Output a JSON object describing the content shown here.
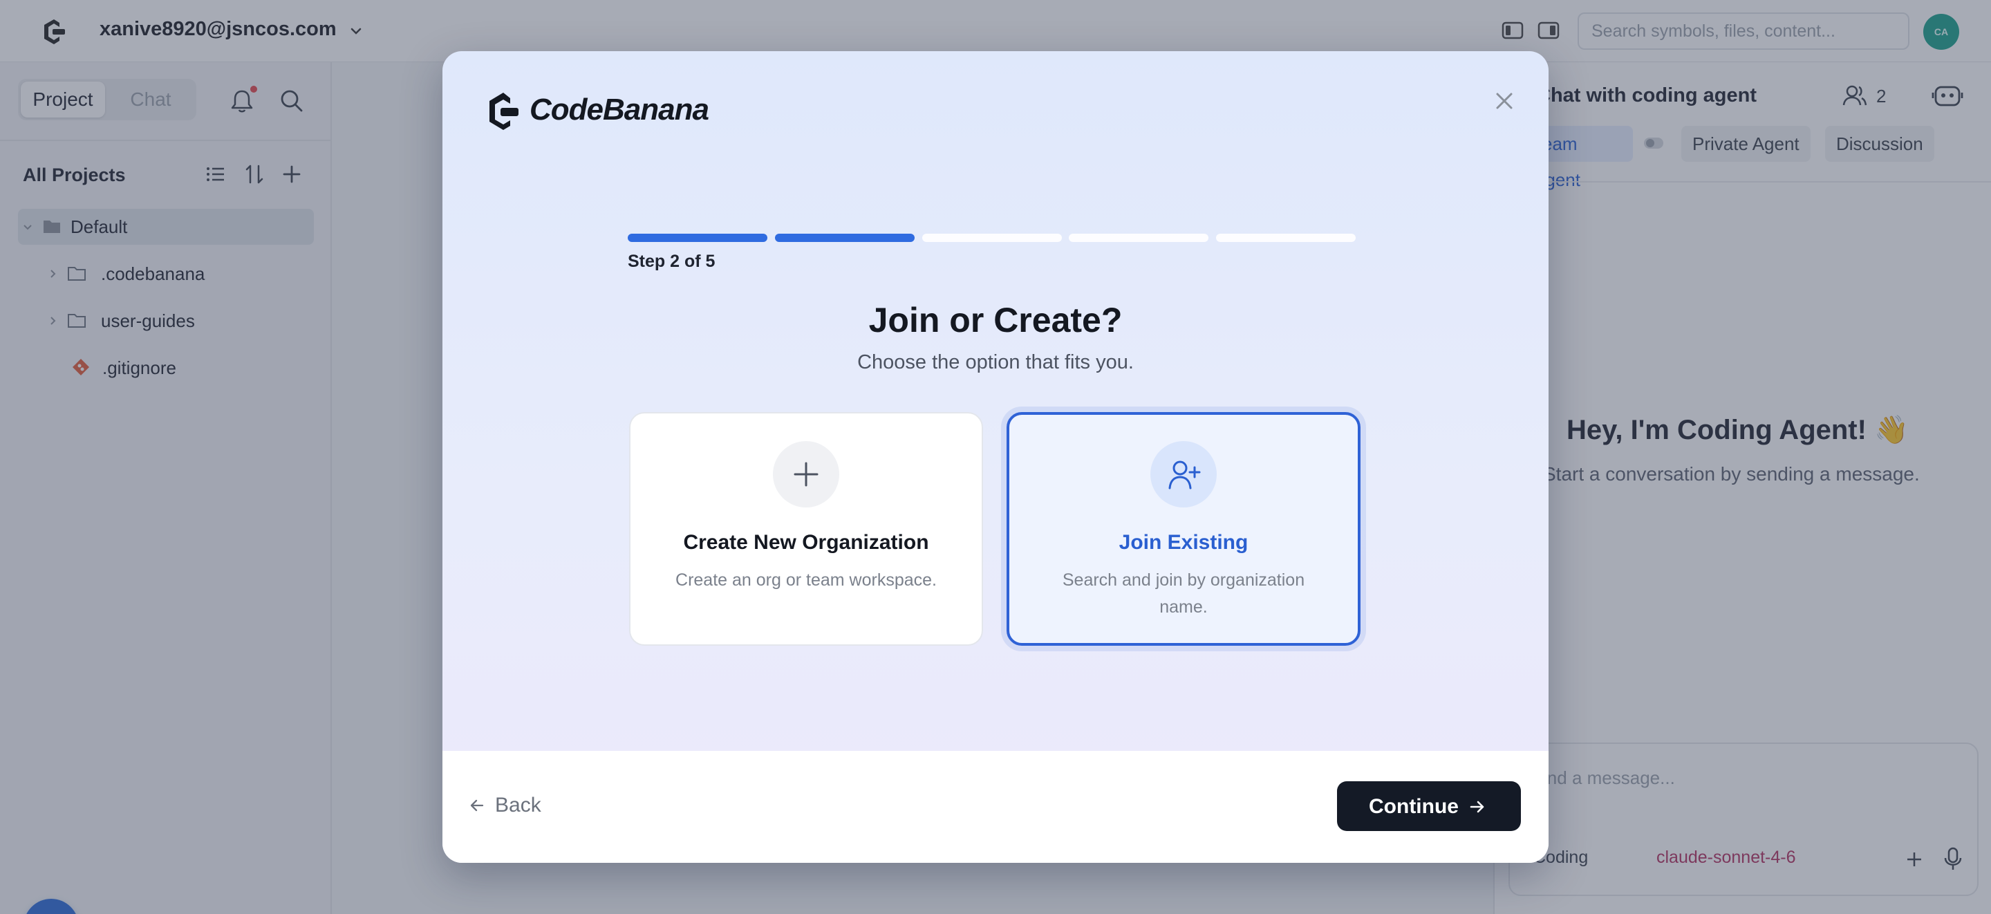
{
  "topbar": {
    "account": "xanive8920@jsncos.com",
    "search_placeholder": "Search symbols, files, content...",
    "avatar_initials": "CA"
  },
  "sidebar": {
    "tabs": [
      "Project",
      "Chat"
    ],
    "section_title": "All Projects",
    "tree": [
      {
        "label": "Default",
        "type": "folder",
        "selected": true
      },
      {
        "label": ".codebanana",
        "type": "folder"
      },
      {
        "label": "user-guides",
        "type": "folder"
      },
      {
        "label": ".gitignore",
        "type": "git-file"
      }
    ]
  },
  "right_panel": {
    "title": "Chat with coding agent",
    "members_count": "2",
    "tabs": [
      "Team Agent",
      "Private Agent",
      "Discussion"
    ],
    "greeting": "Hey, I'm Coding Agent! 👋",
    "subtitle": "Start a conversation by sending a message.",
    "composer_placeholder": "Send a message...",
    "mode": "Coding",
    "model": "claude-sonnet-4-6"
  },
  "modal": {
    "brand_name": "CodeBanana",
    "progress": {
      "current": 2,
      "total": 5
    },
    "step_text": "Step 2 of 5",
    "title": "Join or Create?",
    "subtitle": "Choose the option that fits you.",
    "options": [
      {
        "title": "Create New Organization",
        "desc": "Create an org or team workspace.",
        "icon": "plus-icon",
        "selected": false
      },
      {
        "title": "Join Existing",
        "desc": "Search and join by organization name.",
        "icon": "user-plus-icon",
        "selected": true
      }
    ],
    "back_label": "Back",
    "continue_label": "Continue"
  },
  "colors": {
    "accent": "#2f6be0",
    "primary_button": "#141a26",
    "avatar": "#1aa08a",
    "notification": "#e5484d"
  }
}
